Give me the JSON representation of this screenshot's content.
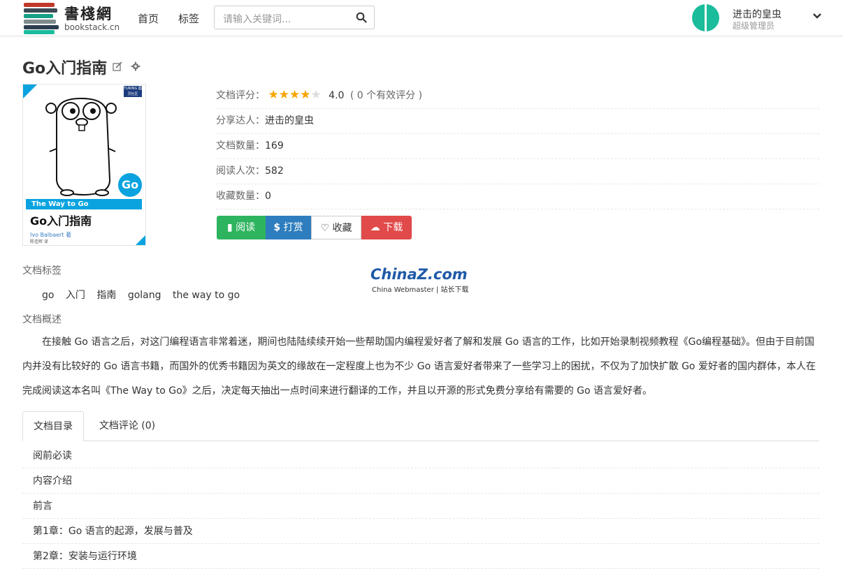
{
  "header": {
    "logo_cn": "書棧網",
    "logo_en": "bookstack.cn",
    "nav": [
      "首页",
      "标签"
    ],
    "search_placeholder": "请输入关键词...",
    "user_name": "进击的皇虫",
    "user_role": "超级管理员"
  },
  "book": {
    "title": "Go入门指南",
    "cover": {
      "band_text": "The Way to Go",
      "title": "Go入门指南",
      "author": "Ivo Balbaert 著",
      "translator": "陈佳晖 译",
      "badge": "Go",
      "publisher_badge": "TURING 图灵社区"
    },
    "rating_label": "文档评分：",
    "rating_value": "4.0",
    "rating_stars": 4,
    "rating_note": "( 0 个有效评分 )",
    "sharer_label": "分享达人：",
    "sharer": "进击的皇虫",
    "doc_count_label": "文档数量：",
    "doc_count": "169",
    "read_count_label": "阅读人次：",
    "read_count": "582",
    "fav_count_label": "收藏数量：",
    "fav_count": "0"
  },
  "actions": {
    "read": "阅读",
    "reward": "打赏",
    "favorite": "收藏",
    "download": "下载"
  },
  "tags_label": "文档标签",
  "tags": [
    "go",
    "入门",
    "指南",
    "golang",
    "the way to go"
  ],
  "watermark": {
    "main": "ChinaZ.com",
    "sub": "China Webmaster | 站长下载"
  },
  "summary_label": "文档概述",
  "summary": "在接触 Go 语言之后，对这门编程语言非常着迷，期间也陆陆续续开始一些帮助国内编程爱好者了解和发展 Go 语言的工作，比如开始录制视频教程《Go编程基础》。但由于目前国内并没有比较好的 Go 语言书籍，而国外的优秀书籍因为英文的缘故在一定程度上也为不少 Go 语言爱好者带来了一些学习上的困扰，不仅为了加快扩散 Go 爱好者的国内群体，本人在完成阅读这本名叫《The Way to Go》之后，决定每天抽出一点时间来进行翻译的工作，并且以开源的形式免费分享给有需要的 Go 语言爱好者。",
  "tabs": [
    "文档目录",
    "文档评论 (0)"
  ],
  "toc": [
    "阅前必读",
    "内容介绍",
    "前言",
    "第1章：Go 语言的起源，发展与普及",
    "第2章：安装与运行环境"
  ],
  "colors": {
    "read_btn": "#2eb45f",
    "reward_btn": "#2e7dbe",
    "download_btn": "#e14a4a",
    "star": "#f7a400",
    "avatar": "#1abc9c"
  }
}
